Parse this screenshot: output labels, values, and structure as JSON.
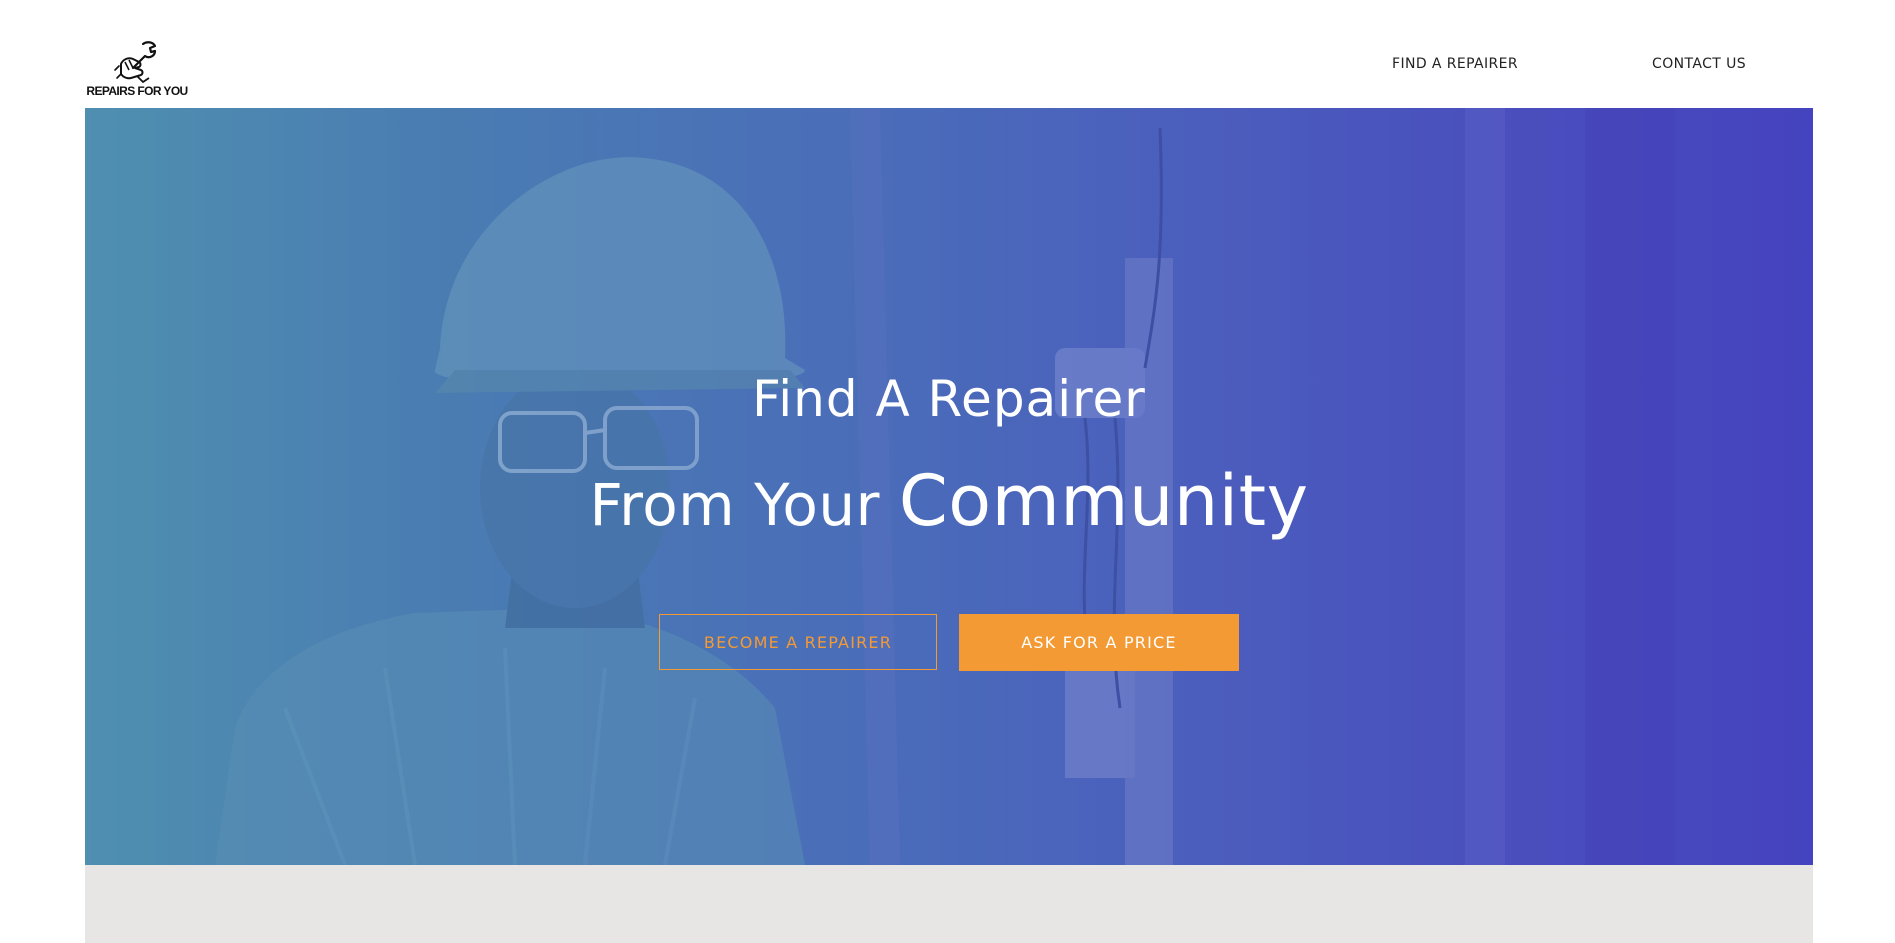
{
  "site": {
    "logo_text": "REPAIRS FOR YOU",
    "logo_icon": "hand-wrench-icon"
  },
  "nav": {
    "items": [
      {
        "label": "FIND A REPAIRER"
      },
      {
        "label": "CONTACT US"
      }
    ]
  },
  "hero": {
    "title": "Find A Repairer",
    "subtitle_part1": "From Your ",
    "subtitle_part2": "Community",
    "background_image": "repair-worker-hard-hat-photo",
    "buttons": {
      "become_label": "BECOME A REPAIRER",
      "ask_label": "ASK FOR A PRICE"
    }
  },
  "colors": {
    "accent": "#f39a35",
    "hero_gradient_left": "#4f8fb0",
    "hero_gradient_right": "#4543bf",
    "band": "#e7e6e5"
  }
}
